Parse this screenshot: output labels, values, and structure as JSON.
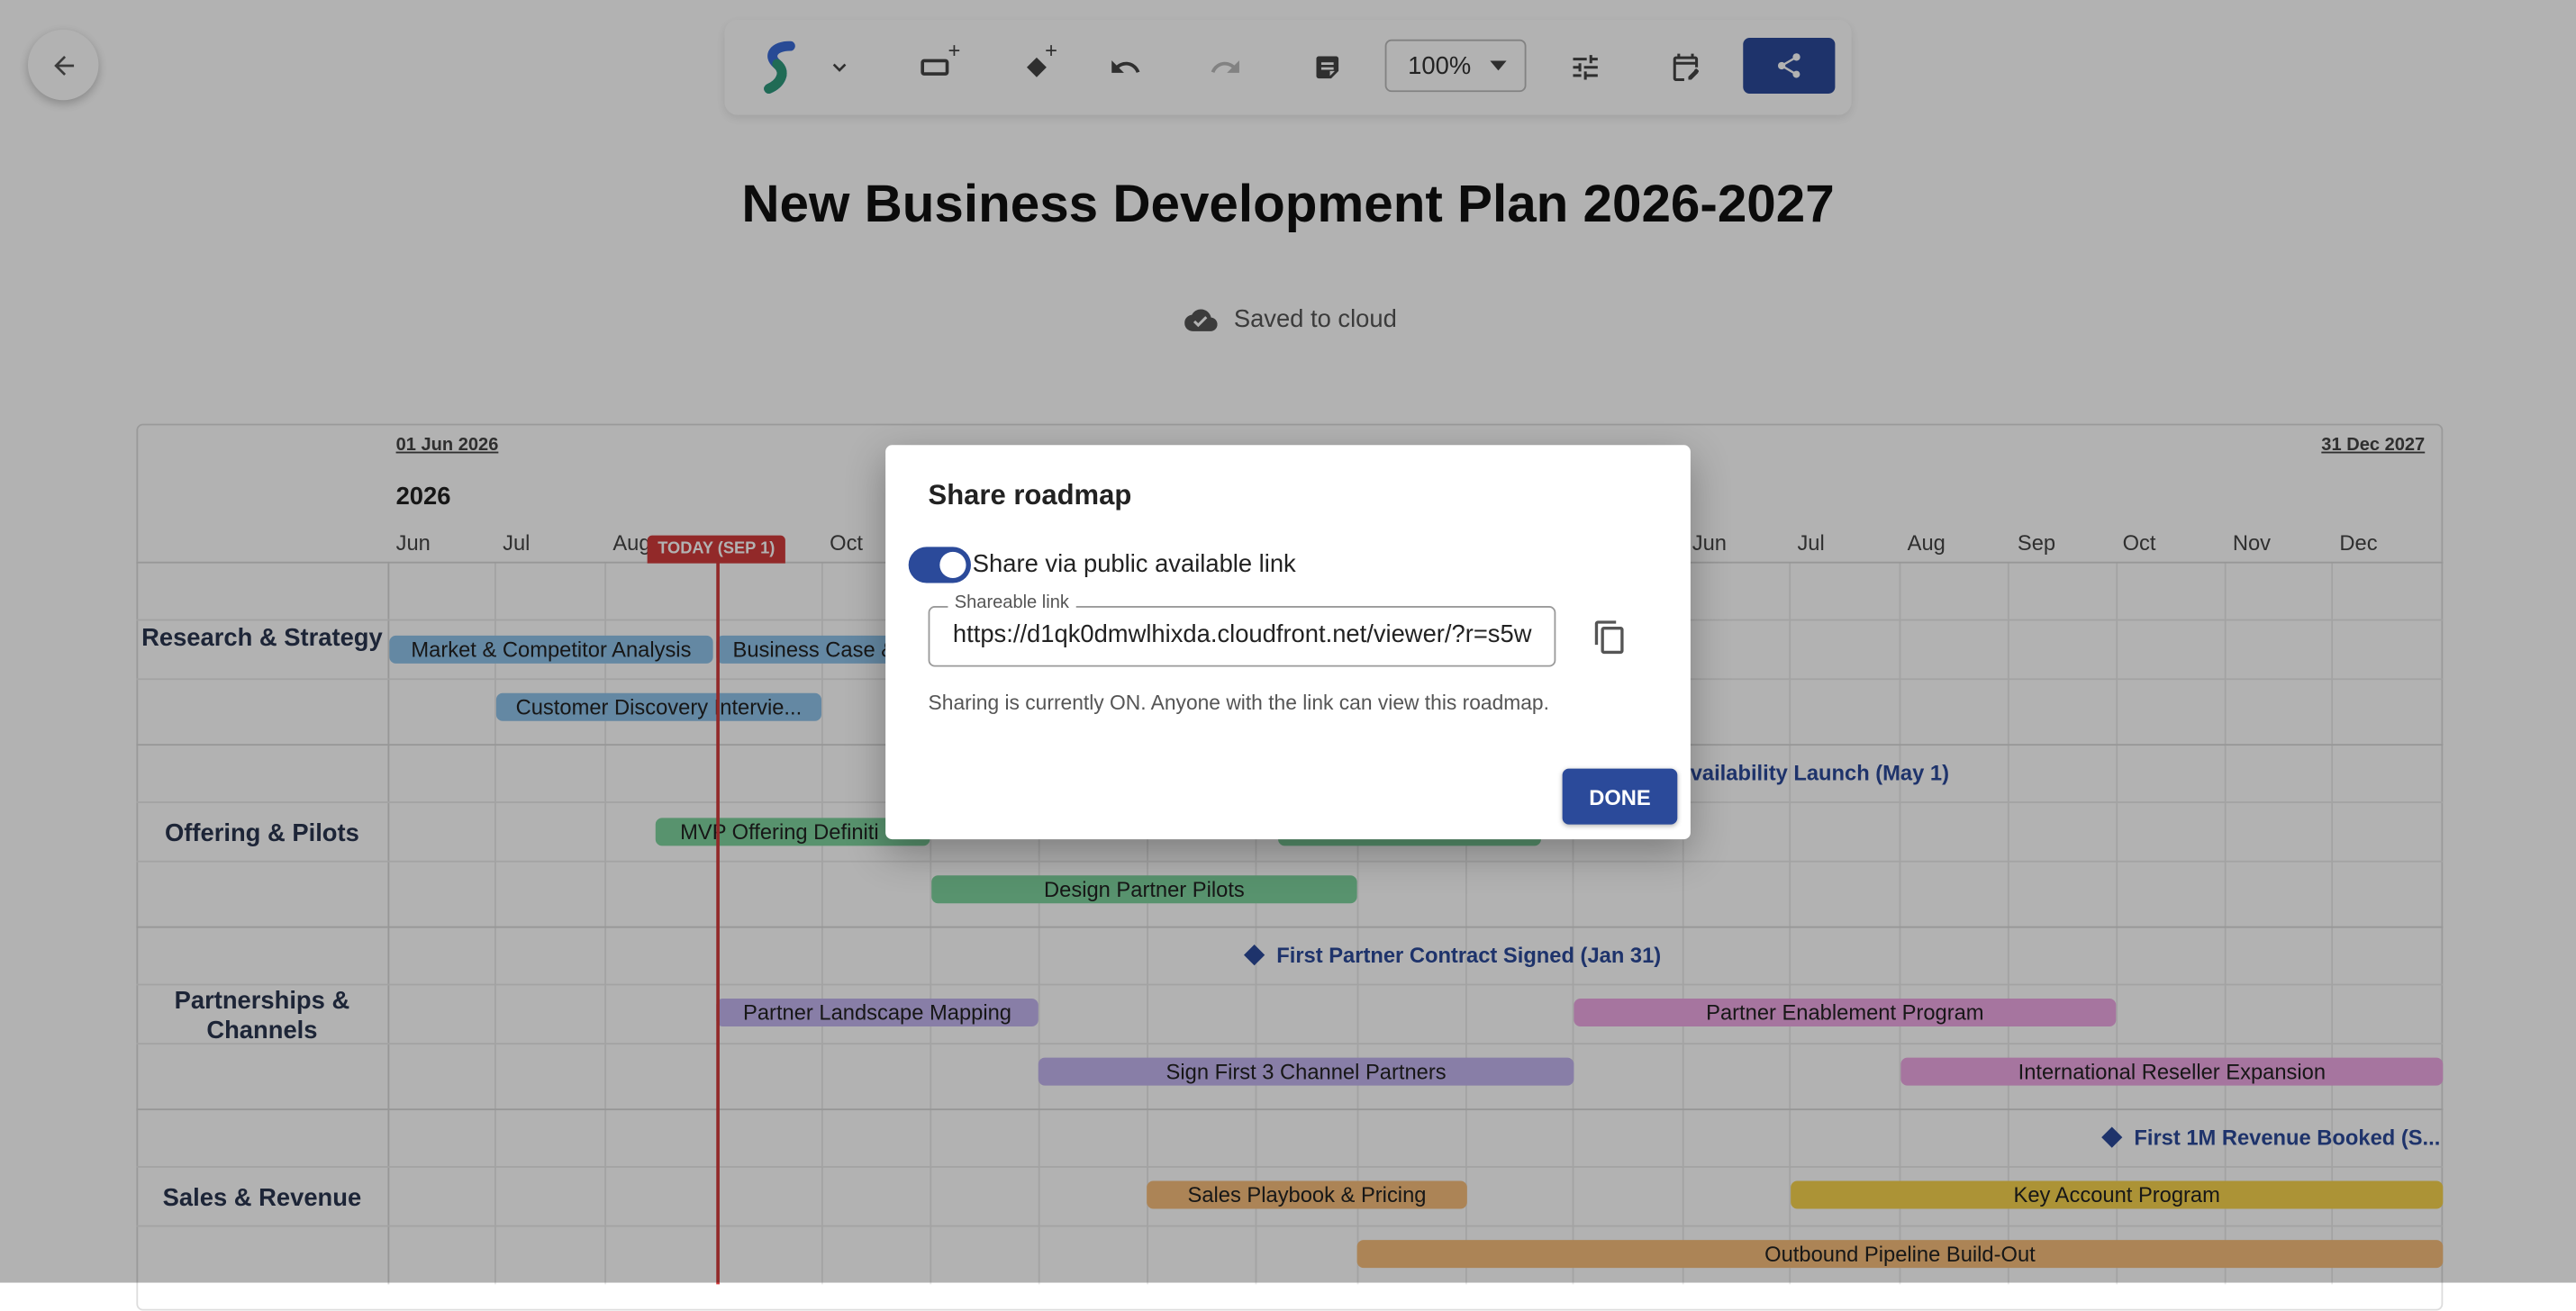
{
  "toolbar": {
    "zoom_value": "100%",
    "plus_sign": "+"
  },
  "plan": {
    "title": "New Business Development Plan 2026-2027",
    "save_status": "Saved to cloud"
  },
  "timeline": {
    "start_date": "01 Jun 2026",
    "end_date": "31 Dec 2027",
    "year_label": "2026",
    "today_label": "TODAY (SEP 1)",
    "months": [
      "Jun",
      "Jul",
      "Aug",
      "Oct",
      "Jun",
      "Jul",
      "Aug",
      "Sep",
      "Oct",
      "Nov",
      "Dec"
    ]
  },
  "lanes": [
    {
      "label": "Research & Strategy"
    },
    {
      "label": "Offering & Pilots"
    },
    {
      "label": "Partnerships & Channels"
    },
    {
      "label": "Sales & Revenue"
    }
  ],
  "bars": [
    {
      "label": "Market & Competitor Analysis",
      "color": "#90c3ea"
    },
    {
      "label": "Business Case &",
      "color": "#90c3ea"
    },
    {
      "label": "Customer Discovery Intervie...",
      "color": "#90c3ea"
    },
    {
      "label": "MVP Offering Definiti",
      "color": "#7fd39e"
    },
    {
      "label": "",
      "color": "#7fd39e"
    },
    {
      "label": "Design Partner Pilots",
      "color": "#7fd39e"
    },
    {
      "label": "Partner Landscape Mapping",
      "color": "#c3b5ef"
    },
    {
      "label": "Partner Enablement Program",
      "color": "#eea8e4"
    },
    {
      "label": "Sign First 3 Channel Partners",
      "color": "#c3b5ef"
    },
    {
      "label": "International Reseller Expansion",
      "color": "#eea8e4"
    },
    {
      "label": "Sales Playbook & Pricing",
      "color": "#f6be7c"
    },
    {
      "label": "Key Account Program",
      "color": "#f6d34e"
    },
    {
      "label": "Outbound Pipeline Build-Out",
      "color": "#f6be7c"
    }
  ],
  "milestones": [
    {
      "label": "Availability Launch (May 1)"
    },
    {
      "label": "First Partner Contract Signed (Jan 31)"
    },
    {
      "label": "First 1M Revenue Booked (S..."
    }
  ],
  "share_dialog": {
    "title": "Share roadmap",
    "toggle_label": "Share via public available link",
    "toggle_on": true,
    "link_field_label": "Shareable link",
    "link_value": "https://d1qk0dmwlhixda.cloudfront.net/viewer/?r=s5w",
    "status_text": "Sharing is currently ON. Anyone with the link can view this roadmap.",
    "done_label": "DONE"
  }
}
